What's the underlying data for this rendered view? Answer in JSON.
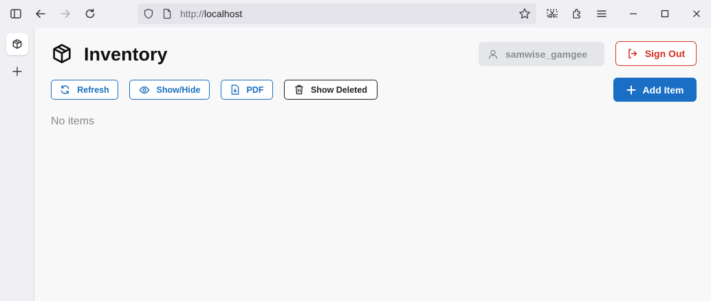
{
  "browser": {
    "url": "http://localhost",
    "url_prefix": "http://",
    "url_host": "localhost"
  },
  "app": {
    "title": "Inventory",
    "username": "samwise_gamgee",
    "sign_out_label": "Sign Out"
  },
  "toolbar": {
    "refresh_label": "Refresh",
    "show_hide_label": "Show/Hide",
    "pdf_label": "PDF",
    "show_deleted_label": "Show Deleted",
    "add_item_label": "Add Item"
  },
  "content": {
    "empty_message": "No items"
  },
  "colors": {
    "primary": "#1a6fc4",
    "danger": "#d93a2b",
    "muted_chip": "#e4e6e9"
  },
  "icons": [
    "sidebar-toggle-icon",
    "back-arrow-icon",
    "forward-arrow-icon",
    "reload-icon",
    "shield-icon",
    "page-icon",
    "star-icon",
    "screenshot-icon",
    "extensions-icon",
    "menu-icon",
    "minimize-icon",
    "maximize-icon",
    "close-icon",
    "box-icon",
    "plus-icon",
    "user-icon",
    "sign-out-icon",
    "refresh-icon",
    "eye-icon",
    "pdf-file-icon",
    "trash-icon"
  ]
}
